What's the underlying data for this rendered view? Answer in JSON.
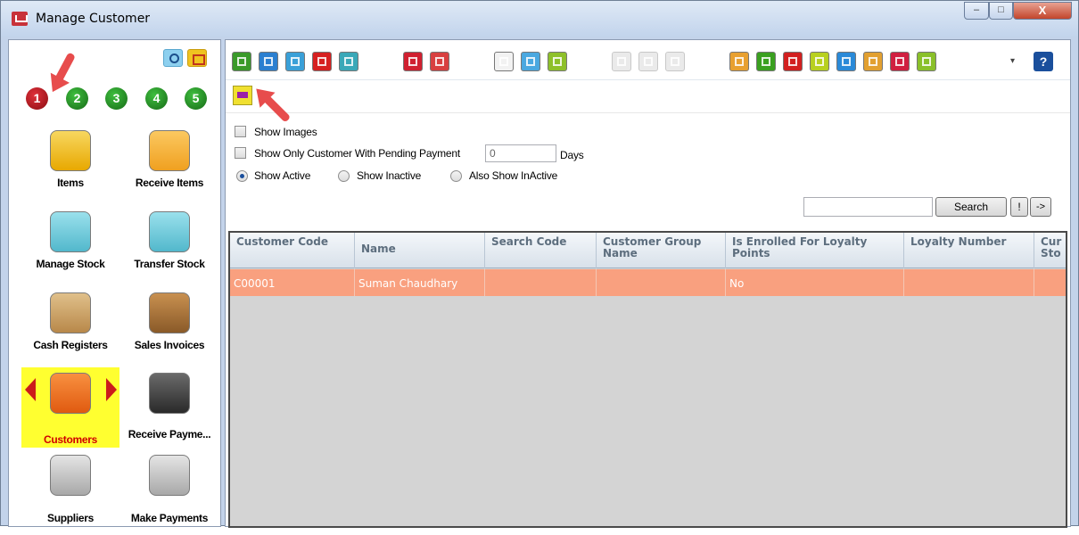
{
  "window": {
    "title": "Manage Customer",
    "controls": {
      "minimize": "–",
      "maximize": "□",
      "close": "X"
    }
  },
  "sidebar": {
    "tool_icons": [
      "search-icon",
      "list-icon"
    ],
    "pages": [
      "1",
      "2",
      "3",
      "4",
      "5"
    ],
    "active_page": "1",
    "items": [
      {
        "label": "Items",
        "icon": "cart-icon",
        "color": "#f0c230"
      },
      {
        "label": "Receive Items",
        "icon": "truck-icon",
        "color": "#f6b73c"
      },
      {
        "label": "Manage Stock",
        "icon": "trolley-icon",
        "color": "#6ec8d8"
      },
      {
        "label": "Transfer Stock",
        "icon": "transfer-icon",
        "color": "#6ec8d8"
      },
      {
        "label": "Cash Registers",
        "icon": "cash-register-icon",
        "color": "#c9a36a"
      },
      {
        "label": "Sales Invoices",
        "icon": "invoice-icon",
        "color": "#b07a3c"
      },
      {
        "label": "Customers",
        "icon": "customers-icon",
        "color": "#f06a20",
        "selected": true
      },
      {
        "label": "Receive Payme...",
        "icon": "receive-payment-icon",
        "color": "#4a4a4a"
      },
      {
        "label": "Suppliers",
        "icon": "factory-icon",
        "color": "#bbbbbb"
      },
      {
        "label": "Make Payments",
        "icon": "make-payment-icon",
        "color": "#bbbbbb"
      }
    ]
  },
  "toolbar": {
    "buttons": [
      {
        "name": "add-button",
        "icon": "plus-icon",
        "color": "#3a9a2a"
      },
      {
        "name": "edit-button",
        "icon": "pencil-icon",
        "color": "#2b7fd0"
      },
      {
        "name": "view-button",
        "icon": "magnifier-icon",
        "color": "#3aa0d8"
      },
      {
        "name": "delete-button",
        "icon": "minus-icon",
        "color": "#d62020"
      },
      {
        "name": "sign-button",
        "icon": "signature-icon",
        "color": "#3aa8b8"
      },
      {
        "name": "card-add-button",
        "icon": "card-add-icon",
        "color": "#d02030"
      },
      {
        "name": "card-view-button",
        "icon": "card-view-icon",
        "color": "#d84040"
      },
      {
        "name": "new-doc-button",
        "icon": "document-icon",
        "color": "#f2f2f2"
      },
      {
        "name": "import-button",
        "icon": "import-icon",
        "color": "#4aa8e0"
      },
      {
        "name": "customer-price-button",
        "icon": "customer-price-icon",
        "color": "#8ec02a"
      },
      {
        "name": "disabled-1-button",
        "icon": "disabled-icon",
        "color": "#cccccc",
        "disabled": true
      },
      {
        "name": "disabled-2-button",
        "icon": "disabled-icon",
        "color": "#cccccc",
        "disabled": true
      },
      {
        "name": "disabled-3-button",
        "icon": "disabled-icon",
        "color": "#cccccc",
        "disabled": true
      },
      {
        "name": "report-1-button",
        "icon": "calendar-report-icon",
        "color": "#e8a030"
      },
      {
        "name": "report-2-button",
        "icon": "calendar-icon",
        "color": "#3aa020"
      },
      {
        "name": "report-3-button",
        "icon": "date-icon",
        "color": "#d22020"
      },
      {
        "name": "report-4-button",
        "icon": "rs-icon",
        "color": "#b8d020"
      },
      {
        "name": "report-5-button",
        "icon": "list-check-icon",
        "color": "#2a8ad8"
      },
      {
        "name": "email-button",
        "icon": "email-icon",
        "color": "#e2a030"
      },
      {
        "name": "statement-button",
        "icon": "statement-icon",
        "color": "#d02040"
      },
      {
        "name": "statement-2-button",
        "icon": "statement-icon",
        "color": "#8ac02a"
      }
    ],
    "overflow_label": "▾",
    "help_label": "?"
  },
  "filters": {
    "show_images": "Show Images",
    "show_pending": "Show Only Customer With Pending Payment",
    "days_value": "0",
    "days_label": "Days",
    "show_active": "Show Active",
    "show_inactive": "Show Inactive",
    "also_show_inactive": "Also Show InActive",
    "search_button": "Search",
    "bang_button": "!",
    "go_button": "->"
  },
  "grid": {
    "columns": [
      "Customer Code",
      "Name",
      "Search Code",
      "Customer Group Name",
      "Is Enrolled For Loyalty Points",
      "Loyalty Number",
      "Cur Sto"
    ],
    "rows": [
      [
        "C00001",
        "Suman Chaudhary",
        "",
        "",
        "No",
        "",
        ""
      ]
    ]
  }
}
